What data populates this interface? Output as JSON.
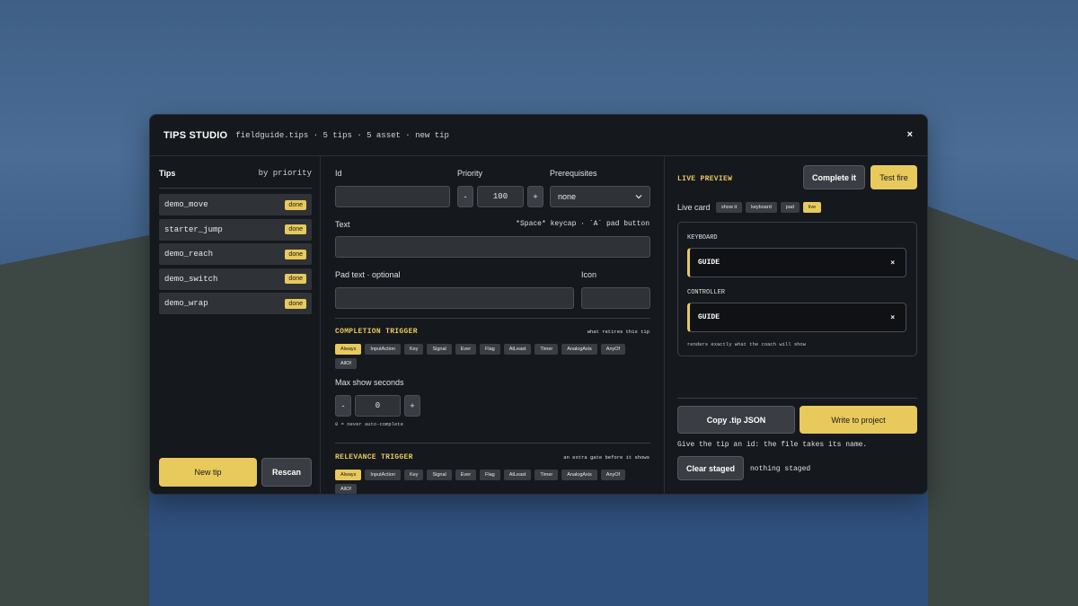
{
  "app": {
    "title": "TIPS STUDIO",
    "meta": "fieldguide.tips · 5 tips · 5 asset · new tip",
    "close": "×"
  },
  "sidebar": {
    "title": "Tips",
    "sort": "by priority",
    "items": [
      {
        "name": "demo_move",
        "badge": "done"
      },
      {
        "name": "starter_jump",
        "badge": "done"
      },
      {
        "name": "demo_reach",
        "badge": "done"
      },
      {
        "name": "demo_switch",
        "badge": "done"
      },
      {
        "name": "demo_wrap",
        "badge": "done"
      }
    ],
    "new_tip": "New tip",
    "rescan": "Rescan"
  },
  "editor": {
    "id_label": "Id",
    "id_value": "",
    "priority_label": "Priority",
    "priority_minus": "-",
    "priority_value": "100",
    "priority_plus": "+",
    "prereq_label": "Prerequisites",
    "prereq_value": "none",
    "text_label": "Text",
    "text_hint": "*Space* keycap · `A` pad button",
    "text_value": "",
    "pad_label": "Pad text · optional",
    "pad_value": "",
    "icon_label": "Icon",
    "icon_value": "",
    "completion": {
      "title": "COMPLETION TRIGGER",
      "note": "what retires this tip",
      "chips": [
        "Always",
        "InputAction",
        "Key",
        "Signal",
        "Ever",
        "Flag",
        "AtLeast",
        "Timer",
        "AnalogAxis",
        "AnyOf",
        "AllOf"
      ],
      "active": "Always"
    },
    "max_show": {
      "label": "Max show seconds",
      "minus": "-",
      "value": "0",
      "plus": "+",
      "hint": "0 = never auto-complete"
    },
    "relevance": {
      "title": "RELEVANCE TRIGGER",
      "note": "an extra gate before it shows",
      "chips": [
        "Always",
        "InputAction",
        "Key",
        "Signal",
        "Ever",
        "Flag",
        "AtLeast",
        "Timer",
        "AnalogAxis",
        "AnyOf",
        "AllOf"
      ],
      "active": "Always"
    }
  },
  "preview": {
    "title": "LIVE PREVIEW",
    "complete_btn": "Complete it",
    "test_fire_btn": "Test fire",
    "live_card_label": "Live card",
    "modes": [
      "show it",
      "keyboard",
      "pad",
      "live"
    ],
    "active_mode": "live",
    "keyboard_label": "KEYBOARD",
    "keyboard_card": "GUIDE",
    "controller_label": "CONTROLLER",
    "controller_card": "GUIDE",
    "card_close": "×",
    "note": "renders exactly what the coach will show",
    "copy_btn": "Copy .tip JSON",
    "write_btn": "Write to project",
    "hint": "Give the tip an id: the file takes its name.",
    "clear_btn": "Clear staged",
    "staged_status": "nothing staged"
  },
  "colors": {
    "accent": "#e8c95c",
    "panel": "#15181d",
    "field": "#2f3338"
  }
}
